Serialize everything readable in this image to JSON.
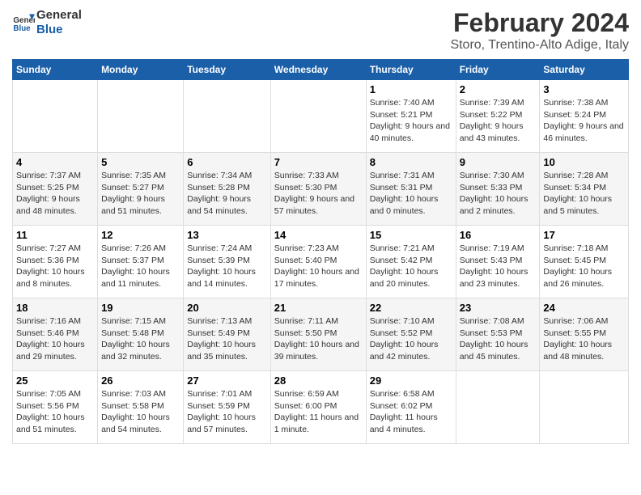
{
  "logo": {
    "line1": "General",
    "line2": "Blue"
  },
  "title": "February 2024",
  "subtitle": "Storo, Trentino-Alto Adige, Italy",
  "weekdays": [
    "Sunday",
    "Monday",
    "Tuesday",
    "Wednesday",
    "Thursday",
    "Friday",
    "Saturday"
  ],
  "weeks": [
    [
      {
        "day": "",
        "sunrise": "",
        "sunset": "",
        "daylight": ""
      },
      {
        "day": "",
        "sunrise": "",
        "sunset": "",
        "daylight": ""
      },
      {
        "day": "",
        "sunrise": "",
        "sunset": "",
        "daylight": ""
      },
      {
        "day": "",
        "sunrise": "",
        "sunset": "",
        "daylight": ""
      },
      {
        "day": "1",
        "sunrise": "Sunrise: 7:40 AM",
        "sunset": "Sunset: 5:21 PM",
        "daylight": "Daylight: 9 hours and 40 minutes."
      },
      {
        "day": "2",
        "sunrise": "Sunrise: 7:39 AM",
        "sunset": "Sunset: 5:22 PM",
        "daylight": "Daylight: 9 hours and 43 minutes."
      },
      {
        "day": "3",
        "sunrise": "Sunrise: 7:38 AM",
        "sunset": "Sunset: 5:24 PM",
        "daylight": "Daylight: 9 hours and 46 minutes."
      }
    ],
    [
      {
        "day": "4",
        "sunrise": "Sunrise: 7:37 AM",
        "sunset": "Sunset: 5:25 PM",
        "daylight": "Daylight: 9 hours and 48 minutes."
      },
      {
        "day": "5",
        "sunrise": "Sunrise: 7:35 AM",
        "sunset": "Sunset: 5:27 PM",
        "daylight": "Daylight: 9 hours and 51 minutes."
      },
      {
        "day": "6",
        "sunrise": "Sunrise: 7:34 AM",
        "sunset": "Sunset: 5:28 PM",
        "daylight": "Daylight: 9 hours and 54 minutes."
      },
      {
        "day": "7",
        "sunrise": "Sunrise: 7:33 AM",
        "sunset": "Sunset: 5:30 PM",
        "daylight": "Daylight: 9 hours and 57 minutes."
      },
      {
        "day": "8",
        "sunrise": "Sunrise: 7:31 AM",
        "sunset": "Sunset: 5:31 PM",
        "daylight": "Daylight: 10 hours and 0 minutes."
      },
      {
        "day": "9",
        "sunrise": "Sunrise: 7:30 AM",
        "sunset": "Sunset: 5:33 PM",
        "daylight": "Daylight: 10 hours and 2 minutes."
      },
      {
        "day": "10",
        "sunrise": "Sunrise: 7:28 AM",
        "sunset": "Sunset: 5:34 PM",
        "daylight": "Daylight: 10 hours and 5 minutes."
      }
    ],
    [
      {
        "day": "11",
        "sunrise": "Sunrise: 7:27 AM",
        "sunset": "Sunset: 5:36 PM",
        "daylight": "Daylight: 10 hours and 8 minutes."
      },
      {
        "day": "12",
        "sunrise": "Sunrise: 7:26 AM",
        "sunset": "Sunset: 5:37 PM",
        "daylight": "Daylight: 10 hours and 11 minutes."
      },
      {
        "day": "13",
        "sunrise": "Sunrise: 7:24 AM",
        "sunset": "Sunset: 5:39 PM",
        "daylight": "Daylight: 10 hours and 14 minutes."
      },
      {
        "day": "14",
        "sunrise": "Sunrise: 7:23 AM",
        "sunset": "Sunset: 5:40 PM",
        "daylight": "Daylight: 10 hours and 17 minutes."
      },
      {
        "day": "15",
        "sunrise": "Sunrise: 7:21 AM",
        "sunset": "Sunset: 5:42 PM",
        "daylight": "Daylight: 10 hours and 20 minutes."
      },
      {
        "day": "16",
        "sunrise": "Sunrise: 7:19 AM",
        "sunset": "Sunset: 5:43 PM",
        "daylight": "Daylight: 10 hours and 23 minutes."
      },
      {
        "day": "17",
        "sunrise": "Sunrise: 7:18 AM",
        "sunset": "Sunset: 5:45 PM",
        "daylight": "Daylight: 10 hours and 26 minutes."
      }
    ],
    [
      {
        "day": "18",
        "sunrise": "Sunrise: 7:16 AM",
        "sunset": "Sunset: 5:46 PM",
        "daylight": "Daylight: 10 hours and 29 minutes."
      },
      {
        "day": "19",
        "sunrise": "Sunrise: 7:15 AM",
        "sunset": "Sunset: 5:48 PM",
        "daylight": "Daylight: 10 hours and 32 minutes."
      },
      {
        "day": "20",
        "sunrise": "Sunrise: 7:13 AM",
        "sunset": "Sunset: 5:49 PM",
        "daylight": "Daylight: 10 hours and 35 minutes."
      },
      {
        "day": "21",
        "sunrise": "Sunrise: 7:11 AM",
        "sunset": "Sunset: 5:50 PM",
        "daylight": "Daylight: 10 hours and 39 minutes."
      },
      {
        "day": "22",
        "sunrise": "Sunrise: 7:10 AM",
        "sunset": "Sunset: 5:52 PM",
        "daylight": "Daylight: 10 hours and 42 minutes."
      },
      {
        "day": "23",
        "sunrise": "Sunrise: 7:08 AM",
        "sunset": "Sunset: 5:53 PM",
        "daylight": "Daylight: 10 hours and 45 minutes."
      },
      {
        "day": "24",
        "sunrise": "Sunrise: 7:06 AM",
        "sunset": "Sunset: 5:55 PM",
        "daylight": "Daylight: 10 hours and 48 minutes."
      }
    ],
    [
      {
        "day": "25",
        "sunrise": "Sunrise: 7:05 AM",
        "sunset": "Sunset: 5:56 PM",
        "daylight": "Daylight: 10 hours and 51 minutes."
      },
      {
        "day": "26",
        "sunrise": "Sunrise: 7:03 AM",
        "sunset": "Sunset: 5:58 PM",
        "daylight": "Daylight: 10 hours and 54 minutes."
      },
      {
        "day": "27",
        "sunrise": "Sunrise: 7:01 AM",
        "sunset": "Sunset: 5:59 PM",
        "daylight": "Daylight: 10 hours and 57 minutes."
      },
      {
        "day": "28",
        "sunrise": "Sunrise: 6:59 AM",
        "sunset": "Sunset: 6:00 PM",
        "daylight": "Daylight: 11 hours and 1 minute."
      },
      {
        "day": "29",
        "sunrise": "Sunrise: 6:58 AM",
        "sunset": "Sunset: 6:02 PM",
        "daylight": "Daylight: 11 hours and 4 minutes."
      },
      {
        "day": "",
        "sunrise": "",
        "sunset": "",
        "daylight": ""
      },
      {
        "day": "",
        "sunrise": "",
        "sunset": "",
        "daylight": ""
      }
    ]
  ]
}
